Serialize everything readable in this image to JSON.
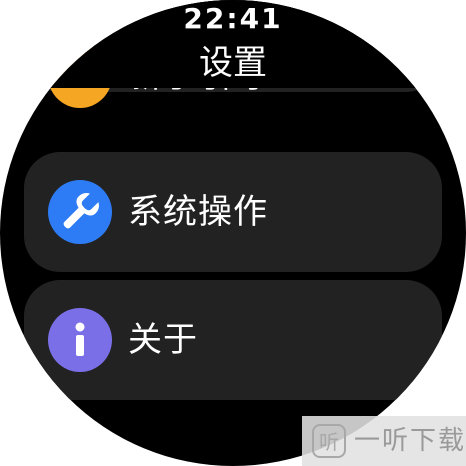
{
  "status_bar": {
    "time": "22:41"
  },
  "header": {
    "title": "设置"
  },
  "menu": {
    "items": [
      {
        "label": "新手引导",
        "icon": "lightbulb-icon",
        "color": "#F5A623"
      },
      {
        "label": "系统操作",
        "icon": "wrench-icon",
        "color": "#2D7CF6"
      },
      {
        "label": "关于",
        "icon": "info-icon",
        "color": "#7B6FE8"
      }
    ]
  },
  "watermark": {
    "text": "一听下载",
    "logo_text": "听"
  }
}
